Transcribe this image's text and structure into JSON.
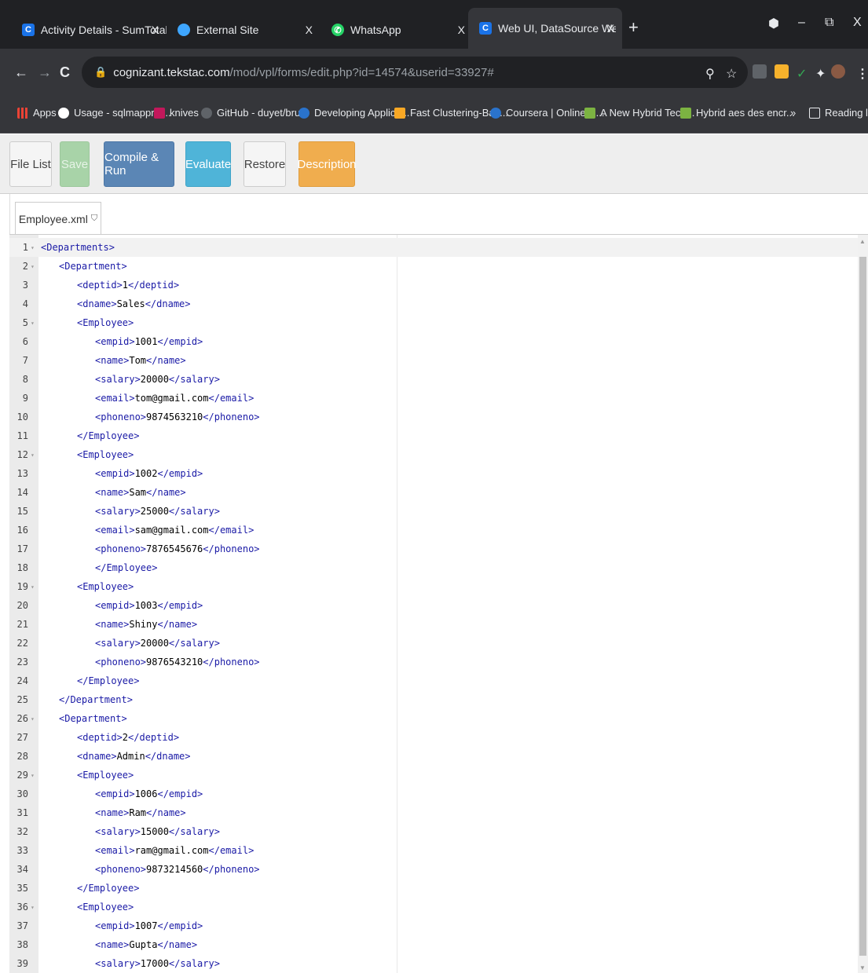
{
  "browser": {
    "tabs": [
      {
        "title": "Activity Details - SumTotal",
        "close": "X"
      },
      {
        "title": "External Site",
        "close": "X"
      },
      {
        "title": "WhatsApp",
        "close": "X"
      },
      {
        "title": "Web UI, DataSource Well Formed",
        "close": "X"
      }
    ],
    "new_tab": "+",
    "window_controls": {
      "minimize": "–",
      "restore": "⧉",
      "close": "X"
    },
    "url_host": "cognizant.tekstac.com",
    "url_path": "/mod/vpl/forms/edit.php?id=14574&userid=33927#",
    "bookmarks": [
      {
        "label": "Apps",
        "icon": "apps-grid-icon"
      },
      {
        "label": "Usage - sqlmapproj...",
        "icon": "github-icon"
      },
      {
        "label": "knives",
        "icon": "mk-icon"
      },
      {
        "label": "GitHub - duyet/bru...",
        "icon": "github-icon"
      },
      {
        "label": "Developing Applica...",
        "icon": "coursera-icon"
      },
      {
        "label": "Fast Clustering-Bas...",
        "icon": "n-icon"
      },
      {
        "label": "Coursera | Online C...",
        "icon": "coursera-icon"
      },
      {
        "label": "A New Hybrid Tech...",
        "icon": "paper-icon"
      },
      {
        "label": "Hybrid aes des encr...",
        "icon": "paper-icon"
      }
    ],
    "more_bookmarks": "»",
    "reading_list": "Reading list"
  },
  "toolbar": {
    "file_list": "File List",
    "save": "Save",
    "compile_run": "Compile & Run",
    "evaluate": "Evaluate",
    "restore": "Restore",
    "description": "Description"
  },
  "file_tab": "Employee.xml",
  "editor": {
    "lines": [
      {
        "n": "1",
        "fold": true,
        "indent": 0,
        "text": "<Departments>"
      },
      {
        "n": "2",
        "fold": true,
        "indent": 1,
        "text": "<Department>"
      },
      {
        "n": "3",
        "fold": false,
        "indent": 2,
        "text": "<deptid>1</deptid>"
      },
      {
        "n": "4",
        "fold": false,
        "indent": 2,
        "text": "<dname>Sales</dname>"
      },
      {
        "n": "5",
        "fold": true,
        "indent": 2,
        "text": "<Employee>"
      },
      {
        "n": "6",
        "fold": false,
        "indent": 3,
        "text": "<empid>1001</empid>"
      },
      {
        "n": "7",
        "fold": false,
        "indent": 3,
        "text": "<name>Tom</name>"
      },
      {
        "n": "8",
        "fold": false,
        "indent": 3,
        "text": "<salary>20000</salary>"
      },
      {
        "n": "9",
        "fold": false,
        "indent": 3,
        "text": "<email>tom@gmail.com</email>"
      },
      {
        "n": "10",
        "fold": false,
        "indent": 3,
        "text": "<phoneno>9874563210</phoneno>"
      },
      {
        "n": "11",
        "fold": false,
        "indent": 2,
        "text": "</Employee>"
      },
      {
        "n": "12",
        "fold": true,
        "indent": 2,
        "text": "<Employee>"
      },
      {
        "n": "13",
        "fold": false,
        "indent": 3,
        "text": "<empid>1002</empid>"
      },
      {
        "n": "14",
        "fold": false,
        "indent": 3,
        "text": "<name>Sam</name>"
      },
      {
        "n": "15",
        "fold": false,
        "indent": 3,
        "text": "<salary>25000</salary>"
      },
      {
        "n": "16",
        "fold": false,
        "indent": 3,
        "text": "<email>sam@gmail.com</email>"
      },
      {
        "n": "17",
        "fold": false,
        "indent": 3,
        "text": "<phoneno>7876545676</phoneno>"
      },
      {
        "n": "18",
        "fold": false,
        "indent": 3,
        "text": "</Employee>"
      },
      {
        "n": "19",
        "fold": true,
        "indent": 2,
        "text": "<Employee>"
      },
      {
        "n": "20",
        "fold": false,
        "indent": 3,
        "text": "<empid>1003</empid>"
      },
      {
        "n": "21",
        "fold": false,
        "indent": 3,
        "text": "<name>Shiny</name>"
      },
      {
        "n": "22",
        "fold": false,
        "indent": 3,
        "text": "<salary>20000</salary>"
      },
      {
        "n": "23",
        "fold": false,
        "indent": 3,
        "text": "<phoneno>9876543210</phoneno>"
      },
      {
        "n": "24",
        "fold": false,
        "indent": 2,
        "text": "</Employee>"
      },
      {
        "n": "25",
        "fold": false,
        "indent": 1,
        "text": "</Department>"
      },
      {
        "n": "26",
        "fold": true,
        "indent": 1,
        "text": "<Department>"
      },
      {
        "n": "27",
        "fold": false,
        "indent": 2,
        "text": "<deptid>2</deptid>"
      },
      {
        "n": "28",
        "fold": false,
        "indent": 2,
        "text": "<dname>Admin</dname>"
      },
      {
        "n": "29",
        "fold": true,
        "indent": 2,
        "text": "<Employee>"
      },
      {
        "n": "30",
        "fold": false,
        "indent": 3,
        "text": "<empid>1006</empid>"
      },
      {
        "n": "31",
        "fold": false,
        "indent": 3,
        "text": "<name>Ram</name>"
      },
      {
        "n": "32",
        "fold": false,
        "indent": 3,
        "text": "<salary>15000</salary>"
      },
      {
        "n": "33",
        "fold": false,
        "indent": 3,
        "text": "<email>ram@gmail.com</email>"
      },
      {
        "n": "34",
        "fold": false,
        "indent": 3,
        "text": "<phoneno>9873214560</phoneno>"
      },
      {
        "n": "35",
        "fold": false,
        "indent": 2,
        "text": "</Employee>"
      },
      {
        "n": "36",
        "fold": true,
        "indent": 2,
        "text": "<Employee>"
      },
      {
        "n": "37",
        "fold": false,
        "indent": 3,
        "text": "<empid>1007</empid>"
      },
      {
        "n": "38",
        "fold": false,
        "indent": 3,
        "text": "<name>Gupta</name>"
      },
      {
        "n": "39",
        "fold": false,
        "indent": 3,
        "text": "<salary>17000</salary>"
      }
    ]
  },
  "colors": {
    "xml_tag": "#1a1aa6",
    "save_disabled": "#a8d3a8",
    "compile_run": "#5b86b5",
    "evaluate": "#4fb4d8",
    "description": "#f0ad4e"
  }
}
